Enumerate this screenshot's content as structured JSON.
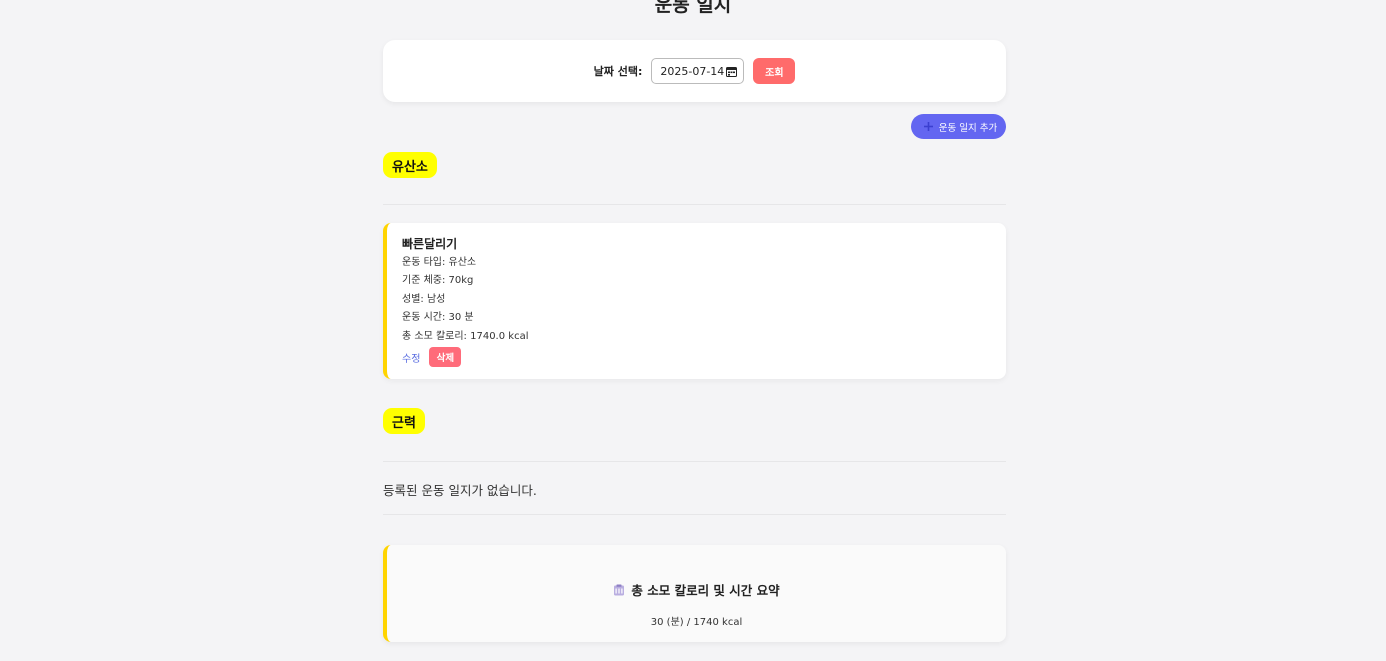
{
  "header": {
    "title": "운동 일지"
  },
  "date_picker": {
    "label": "날짜 선택:",
    "value": "2025-07-14",
    "query_button": "조회"
  },
  "add_button": {
    "label": "운동 일지 추가"
  },
  "sections": [
    {
      "tag": "유산소",
      "entries": [
        {
          "name": "빠른달리기",
          "type_line": "운동 타입: 유산소",
          "weight_line": "기준 체중: 70kg",
          "gender_line": "성별: 남성",
          "time_line": "운동 시간: 30 분",
          "calorie_line": "총 소모 칼로리: 1740.0 kcal",
          "edit_label": "수정",
          "delete_label": "삭제"
        }
      ]
    },
    {
      "tag": "근력",
      "empty_message": "등록된 운동 일지가 없습니다."
    }
  ],
  "summary": {
    "icon": "clipboard-icon",
    "title": "총 소모 칼로리 및 시간 요약",
    "values": "30 (분) / 1740 kcal"
  },
  "colors": {
    "accent_red": "#ff6b6b",
    "accent_indigo": "#6366f1",
    "tag_yellow": "#ffff00",
    "card_border": "#ffd400"
  }
}
